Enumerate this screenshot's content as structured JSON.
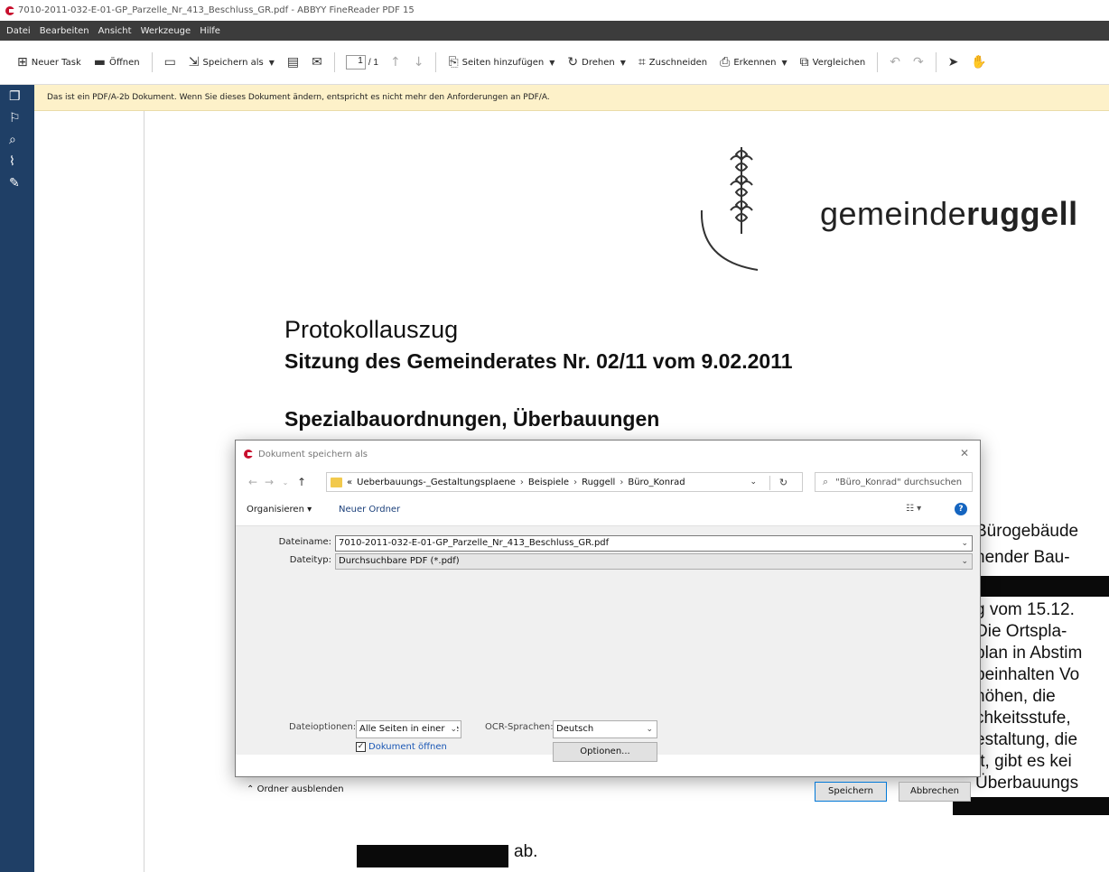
{
  "window": {
    "title": "7010-2011-032-E-01-GP_Parzelle_Nr_413_Beschluss_GR.pdf - ABBYY FineReader PDF 15"
  },
  "menu": [
    "Datei",
    "Bearbeiten",
    "Ansicht",
    "Werkzeuge",
    "Hilfe"
  ],
  "toolbar": {
    "new_task": "Neuer Task",
    "open": "Öffnen",
    "save_as": "Speichern als",
    "page_current": "1",
    "page_total": "/ 1",
    "add_pages": "Seiten hinzufügen",
    "rotate": "Drehen",
    "crop": "Zuschneiden",
    "recognize": "Erkennen",
    "compare": "Vergleichen"
  },
  "notice": "Das ist ein PDF/A-2b Dokument. Wenn Sie dieses Dokument ändern, entspricht es nicht mehr den Anforderungen an PDF/A.",
  "document": {
    "brand_light": "gemeinde",
    "brand_bold": "ruggell",
    "heading1": "Protokollauszug",
    "heading2": "Sitzung des Gemeinderates Nr. 02/11 vom 9.02.2011",
    "heading3": "Spezialbauordnungen, Überbauungen",
    "right_lines": [
      "Bürogebäude",
      "hender Bau-",
      "",
      "g vom 15.12.",
      "Die Ortspla-",
      "plan in Abstim",
      "beinhalten Vo",
      "höhen, die",
      "chkeitsstufe,",
      "estaltung, die",
      "ft, gibt es kei",
      "Überbauungs"
    ],
    "tail": "ab."
  },
  "dialog": {
    "title": "Dokument speichern als",
    "breadcrumb": [
      "«",
      "Ueberbauungs-_Gestaltungsplaene",
      "Beispiele",
      "Ruggell",
      "Büro_Konrad"
    ],
    "search_placeholder": "\"Büro_Konrad\" durchsuchen",
    "organize": "Organisieren",
    "new_folder": "Neuer Ordner",
    "filename_label": "Dateiname:",
    "filename": "7010-2011-032-E-01-GP_Parzelle_Nr_413_Beschluss_GR.pdf",
    "filetype_label": "Dateityp:",
    "filetype": "Durchsuchbare PDF (*.pdf)",
    "file_options_label": "Dateioptionen:",
    "file_options_value": "Alle Seiten in einer ge",
    "open_doc_label": "Dokument öffnen",
    "ocr_label": "OCR-Sprachen:",
    "ocr_value": "Deutsch",
    "options_btn": "Optionen...",
    "hide_folders": "Ordner ausblenden",
    "save_btn": "Speichern",
    "cancel_btn": "Abbrechen"
  }
}
